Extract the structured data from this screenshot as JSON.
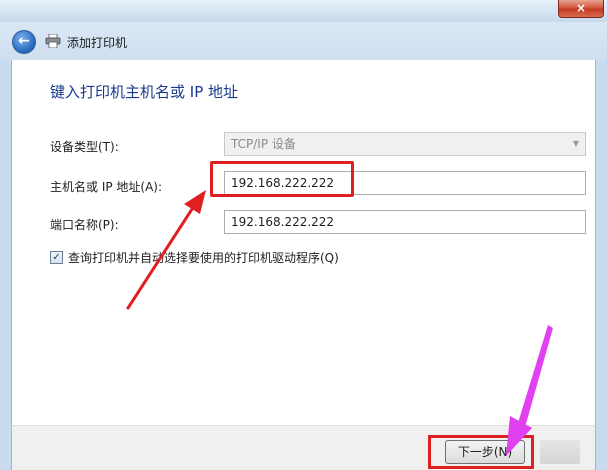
{
  "window": {
    "close_glyph": "×",
    "title": "添加打印机"
  },
  "heading": "键入打印机主机名或 IP 地址",
  "form": {
    "device_type_label": "设备类型(T):",
    "device_type_value": "TCP/IP 设备",
    "hostname_label": "主机名或 IP 地址(A):",
    "hostname_value": "192.168.222.222",
    "port_label": "端口名称(P):",
    "port_value": "192.168.222.222",
    "query_checkbox_label": "查询打印机并自动选择要使用的打印机驱动程序(Q)",
    "query_checked": true
  },
  "footer": {
    "next_label": "下一步(N)"
  },
  "colors": {
    "annotation_red": "#e02020",
    "annotation_magenta": "#e040f0",
    "heading_blue": "#1a3a8f"
  }
}
